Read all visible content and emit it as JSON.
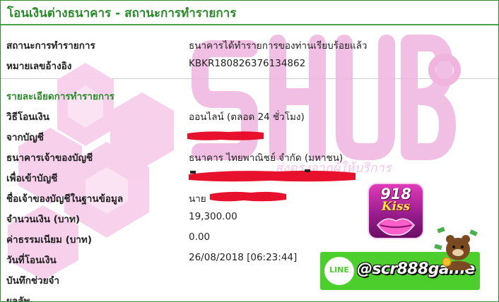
{
  "header": {
    "title": "โอนเงินต่างธนาคาร - สถานะการทำรายการ"
  },
  "summary": {
    "status_label": "สถานะการทำรายการ",
    "status_value": "ธนาคารได้ทำรายการของท่านเรียบร้อยแล้ว",
    "reference_label": "หมายเลขอ้างอิง",
    "reference_value": "KBKR180826376134862"
  },
  "details": {
    "section_title": "รายละเอียดการทำรายการ",
    "method_label": "วิธีโอนเงิน",
    "method_value": "ออนไลน์ (ตลอด 24 ชั่วโมง)",
    "from_account_label": "จากบัญชี",
    "dest_bank_label": "ธนาคารเจ้าของบัญชี",
    "dest_bank_value": "ธนาคาร ไทยพาณิชย์ จำกัด (มหาชน)",
    "to_account_label": "เพื่อเข้าบัญชี",
    "account_name_label": "ชื่อเจ้าของบัญชีในฐานข้อมูล",
    "account_name_prefix": "นาย",
    "amount_label": "จำนวนเงิน (บาท)",
    "amount_value": "19,300.00",
    "fee_label": "ค่าธรรมเนียม (บาท)",
    "fee_value": "0.00",
    "date_label": "วันที่โอนเงิน",
    "date_value": "26/08/2018 [06:23:44]",
    "memo_label": "บันทึกช่วยจำ"
  },
  "overlay": {
    "badge_number": "918",
    "badge_name": "Kiss",
    "line_logo": "LINE",
    "line_handle": "@scr888game",
    "watermark_text": "ส่งตรงจากผู้ให้บริการ"
  },
  "colors": {
    "title_green": "#2a8a2a",
    "line_green": "#4ccf2c",
    "redaction_red": "#e8112d",
    "watermark_pink": "#f4c6e8"
  },
  "icons": [
    "line-logo-icon",
    "kiss-lips-icon",
    "bear-mascot-icon"
  ]
}
